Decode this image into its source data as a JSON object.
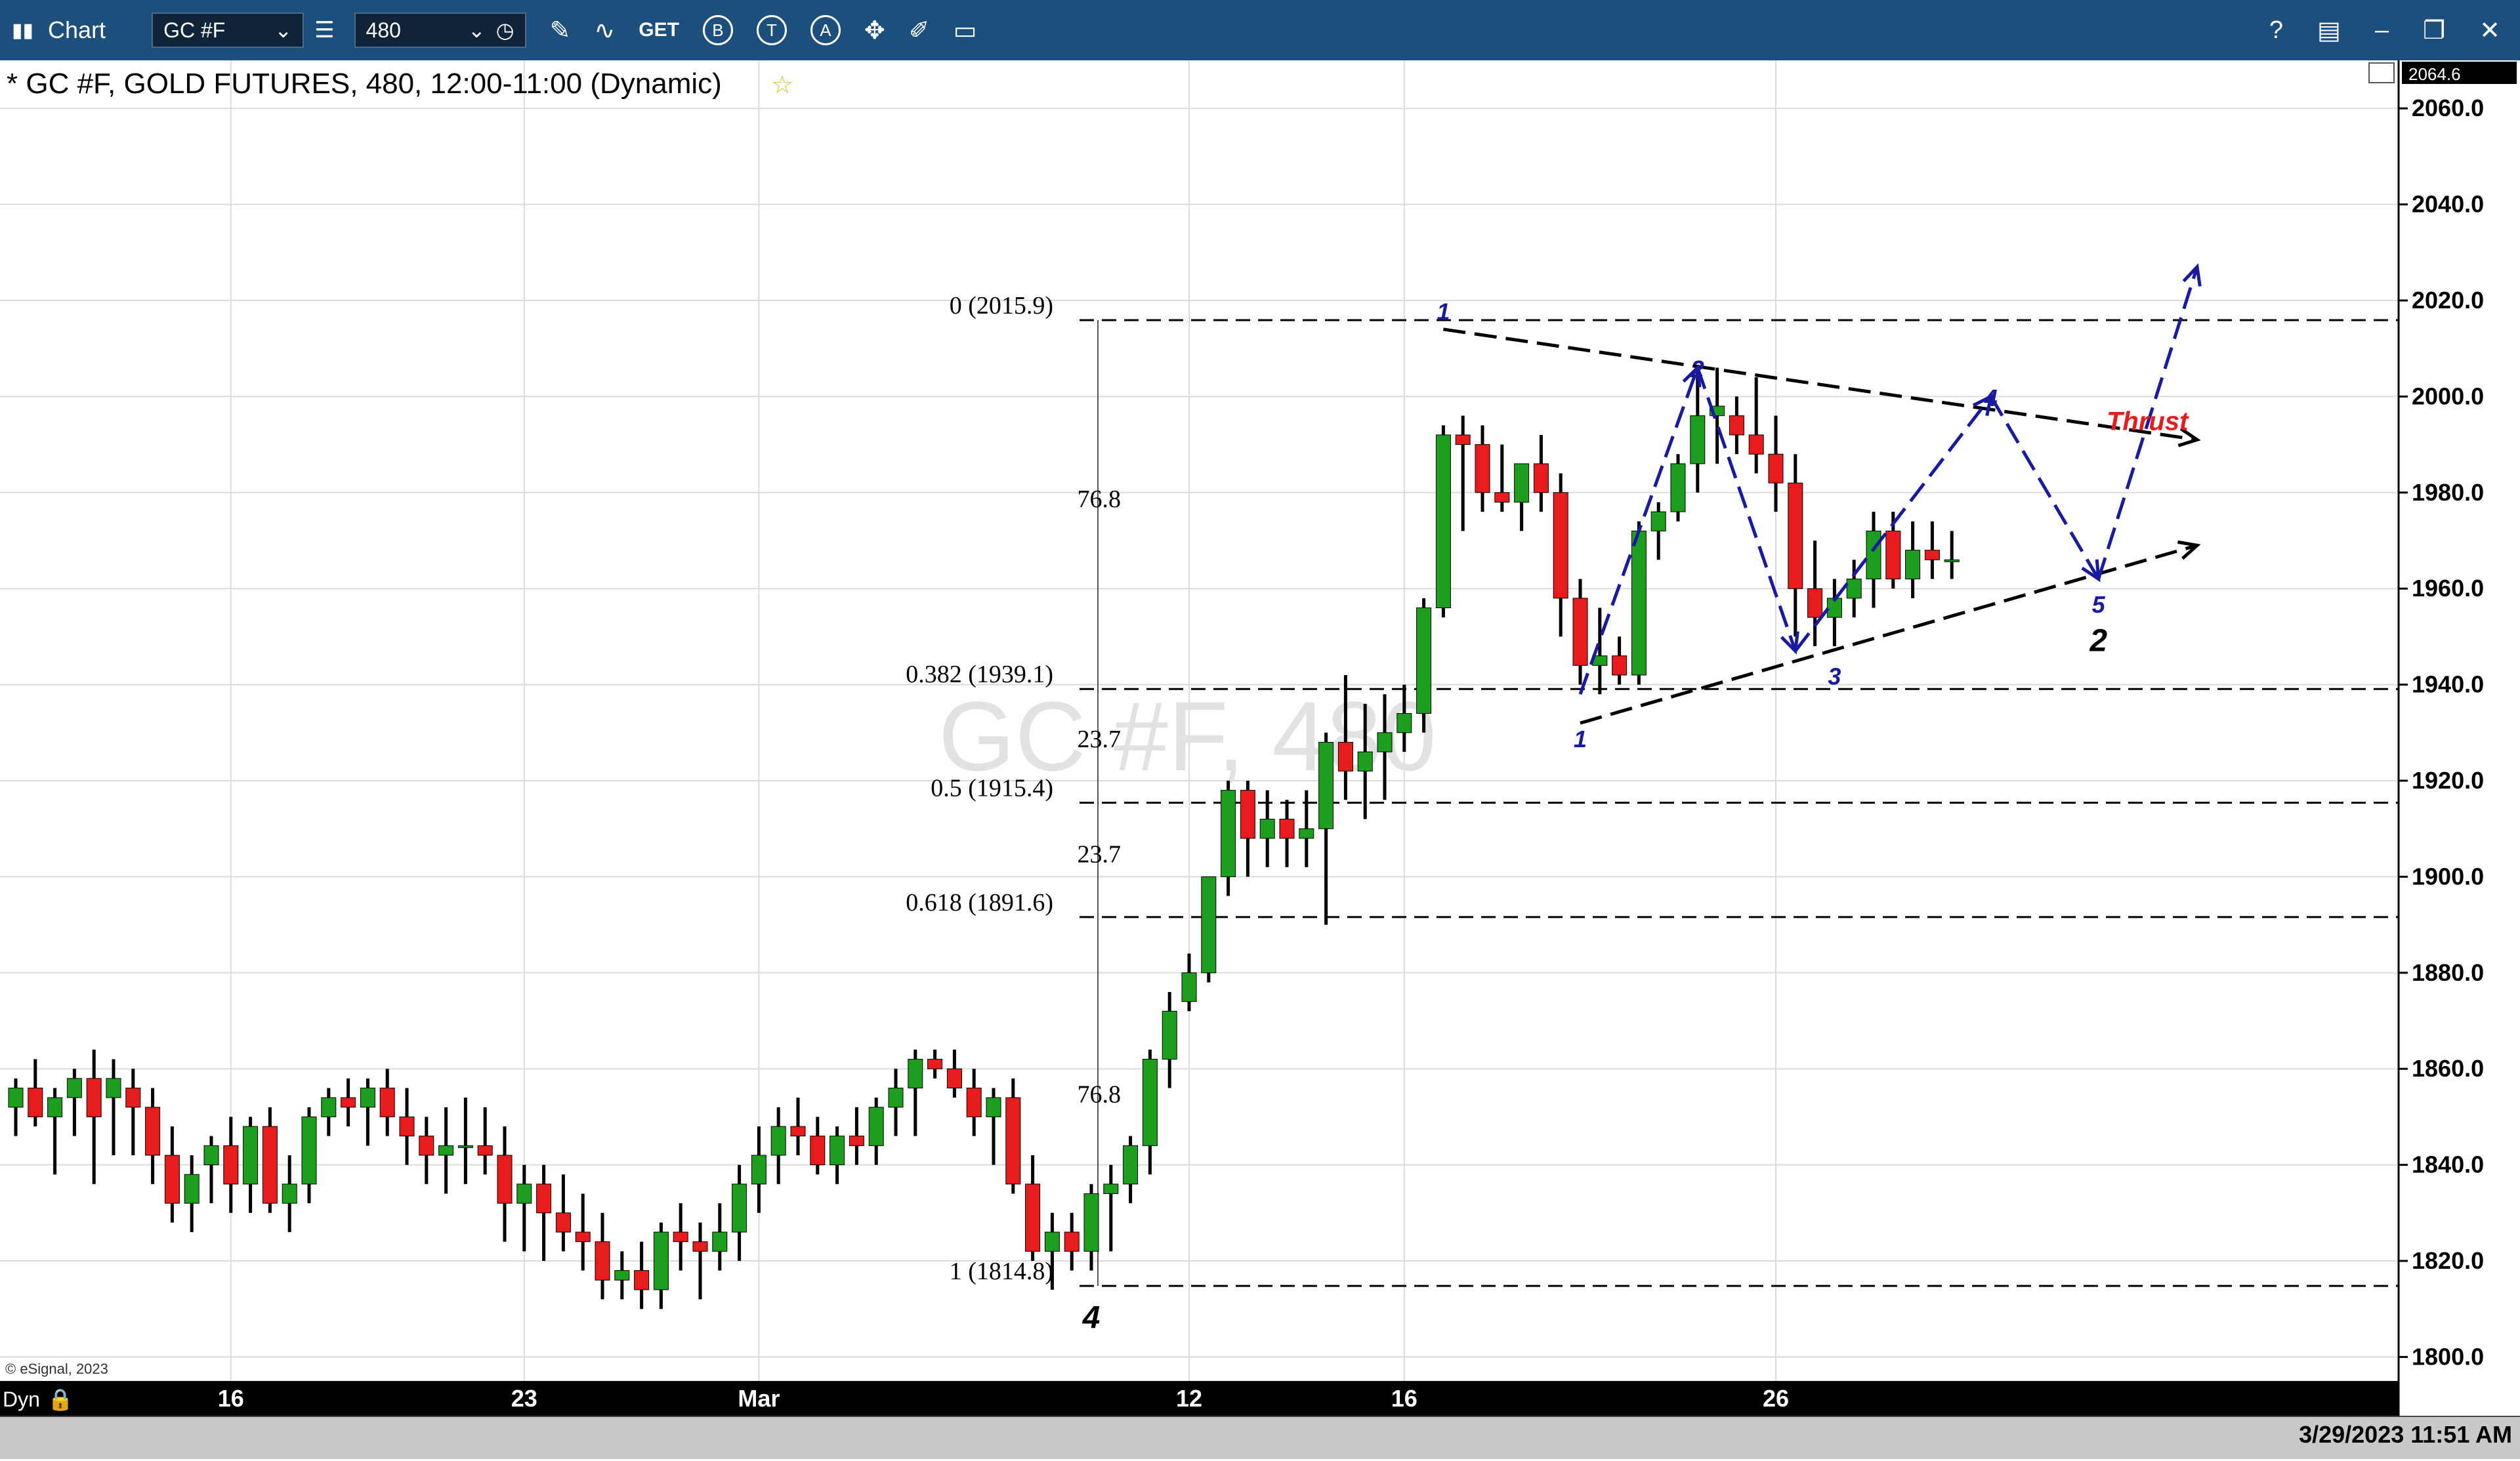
{
  "toolbar": {
    "app_label": "Chart",
    "symbol": "GC #F",
    "interval": "480",
    "get_label": "GET",
    "btn_b": "B",
    "btn_t": "T",
    "btn_a": "A",
    "help": "?"
  },
  "chart_title": "* GC #F, GOLD FUTURES, 480, 12:00-11:00 (Dynamic)",
  "watermark": "GC #F, 480",
  "copyright": "© eSignal, 2023",
  "dyn_label": "Dyn",
  "timestamp": "3/29/2023 11:51 AM",
  "price_top": "2064.6",
  "last_price": "1966.2",
  "colors": {
    "up": "#1e9e1e",
    "down": "#e81c1c",
    "wave": "#1a1a9e",
    "thrust": "#e81c1c",
    "toolbar": "#1d4f7c"
  },
  "chart_data": {
    "type": "candlestick",
    "title": "GC #F, GOLD FUTURES, 480, 12:00-11:00 (Dynamic)",
    "ylim": [
      1795,
      2070
    ],
    "y_ticks": [
      "1800.0",
      "1820.0",
      "1840.0",
      "1860.0",
      "1880.0",
      "1900.0",
      "1920.0",
      "1940.0",
      "1960.0",
      "1980.0",
      "2000.0",
      "2020.0",
      "2040.0",
      "2060.0"
    ],
    "x_ticks": [
      {
        "label": "16",
        "bar": 11
      },
      {
        "label": "23",
        "bar": 26
      },
      {
        "label": "Mar",
        "bar": 38
      },
      {
        "label": "12",
        "bar": 60
      },
      {
        "label": "16",
        "bar": 71
      },
      {
        "label": "26",
        "bar": 90
      }
    ],
    "ohlc": [
      [
        1852,
        1858,
        1846,
        1856
      ],
      [
        1856,
        1862,
        1848,
        1850
      ],
      [
        1850,
        1856,
        1838,
        1854
      ],
      [
        1854,
        1860,
        1846,
        1858
      ],
      [
        1858,
        1864,
        1836,
        1850
      ],
      [
        1854,
        1862,
        1842,
        1858
      ],
      [
        1856,
        1860,
        1842,
        1852
      ],
      [
        1852,
        1856,
        1836,
        1842
      ],
      [
        1842,
        1848,
        1828,
        1832
      ],
      [
        1832,
        1842,
        1826,
        1838
      ],
      [
        1840,
        1846,
        1832,
        1844
      ],
      [
        1844,
        1850,
        1830,
        1836
      ],
      [
        1836,
        1850,
        1830,
        1848
      ],
      [
        1848,
        1852,
        1830,
        1832
      ],
      [
        1832,
        1842,
        1826,
        1836
      ],
      [
        1836,
        1852,
        1832,
        1850
      ],
      [
        1850,
        1856,
        1846,
        1854
      ],
      [
        1854,
        1858,
        1848,
        1852
      ],
      [
        1852,
        1858,
        1844,
        1856
      ],
      [
        1856,
        1860,
        1846,
        1850
      ],
      [
        1850,
        1856,
        1840,
        1846
      ],
      [
        1846,
        1850,
        1836,
        1842
      ],
      [
        1842,
        1852,
        1834,
        1844
      ],
      [
        1844,
        1854,
        1836,
        1844
      ],
      [
        1844,
        1852,
        1838,
        1842
      ],
      [
        1842,
        1848,
        1824,
        1832
      ],
      [
        1832,
        1840,
        1822,
        1836
      ],
      [
        1836,
        1840,
        1820,
        1830
      ],
      [
        1830,
        1838,
        1822,
        1826
      ],
      [
        1826,
        1834,
        1818,
        1824
      ],
      [
        1824,
        1830,
        1812,
        1816
      ],
      [
        1816,
        1822,
        1812,
        1818
      ],
      [
        1818,
        1824,
        1810,
        1814
      ],
      [
        1814,
        1828,
        1810,
        1826
      ],
      [
        1826,
        1832,
        1818,
        1824
      ],
      [
        1824,
        1828,
        1812,
        1822
      ],
      [
        1822,
        1832,
        1818,
        1826
      ],
      [
        1826,
        1840,
        1820,
        1836
      ],
      [
        1836,
        1848,
        1830,
        1842
      ],
      [
        1842,
        1852,
        1836,
        1848
      ],
      [
        1848,
        1854,
        1842,
        1846
      ],
      [
        1846,
        1850,
        1838,
        1840
      ],
      [
        1840,
        1848,
        1836,
        1846
      ],
      [
        1846,
        1852,
        1840,
        1844
      ],
      [
        1844,
        1854,
        1840,
        1852
      ],
      [
        1852,
        1860,
        1846,
        1856
      ],
      [
        1856,
        1864,
        1846,
        1862
      ],
      [
        1862,
        1864,
        1858,
        1860
      ],
      [
        1860,
        1864,
        1854,
        1856
      ],
      [
        1856,
        1860,
        1846,
        1850
      ],
      [
        1850,
        1856,
        1840,
        1854
      ],
      [
        1854,
        1858,
        1834,
        1836
      ],
      [
        1836,
        1842,
        1820,
        1822
      ],
      [
        1822,
        1830,
        1814,
        1826
      ],
      [
        1826,
        1830,
        1818,
        1822
      ],
      [
        1822,
        1836,
        1818,
        1834
      ],
      [
        1834,
        1840,
        1822,
        1836
      ],
      [
        1836,
        1846,
        1832,
        1844
      ],
      [
        1844,
        1864,
        1838,
        1862
      ],
      [
        1862,
        1876,
        1856,
        1872
      ],
      [
        1874,
        1884,
        1872,
        1880
      ],
      [
        1880,
        1896,
        1878,
        1900
      ],
      [
        1900,
        1920,
        1896,
        1918
      ],
      [
        1918,
        1920,
        1900,
        1908
      ],
      [
        1908,
        1918,
        1902,
        1912
      ],
      [
        1912,
        1916,
        1902,
        1908
      ],
      [
        1908,
        1918,
        1902,
        1910
      ],
      [
        1910,
        1930,
        1890,
        1928
      ],
      [
        1928,
        1942,
        1916,
        1922
      ],
      [
        1922,
        1936,
        1912,
        1926
      ],
      [
        1926,
        1938,
        1916,
        1930
      ],
      [
        1930,
        1940,
        1926,
        1934
      ],
      [
        1934,
        1958,
        1930,
        1956
      ],
      [
        1956,
        1994,
        1954,
        1992
      ],
      [
        1992,
        1996,
        1972,
        1990
      ],
      [
        1990,
        1994,
        1976,
        1980
      ],
      [
        1980,
        1990,
        1976,
        1978
      ],
      [
        1978,
        1986,
        1972,
        1986
      ],
      [
        1986,
        1992,
        1976,
        1980
      ],
      [
        1980,
        1984,
        1950,
        1958
      ],
      [
        1958,
        1962,
        1940,
        1944
      ],
      [
        1944,
        1956,
        1938,
        1946
      ],
      [
        1946,
        1950,
        1940,
        1942
      ],
      [
        1942,
        1974,
        1940,
        1972
      ],
      [
        1972,
        1978,
        1966,
        1976
      ],
      [
        1976,
        1988,
        1974,
        1986
      ],
      [
        1986,
        2006,
        1980,
        1996
      ],
      [
        1996,
        2006,
        1986,
        1998
      ],
      [
        1996,
        2000,
        1988,
        1992
      ],
      [
        1992,
        2004,
        1984,
        1988
      ],
      [
        1988,
        1996,
        1976,
        1982
      ],
      [
        1982,
        1988,
        1950,
        1960
      ],
      [
        1960,
        1970,
        1948,
        1954
      ],
      [
        1954,
        1962,
        1948,
        1958
      ],
      [
        1958,
        1966,
        1954,
        1962
      ],
      [
        1962,
        1976,
        1956,
        1972
      ],
      [
        1972,
        1976,
        1960,
        1962
      ],
      [
        1962,
        1974,
        1958,
        1968
      ],
      [
        1968,
        1974,
        1962,
        1966
      ],
      [
        1966,
        1972,
        1962,
        1966
      ]
    ],
    "fib_levels": [
      {
        "label": "0 (2015.9)",
        "value": 2015.9
      },
      {
        "label": "0.382 (1939.1)",
        "value": 1939.1
      },
      {
        "label": "0.5 (1915.4)",
        "value": 1915.4
      },
      {
        "label": "0.618 (1891.6)",
        "value": 1891.6
      },
      {
        "label": "1 (1814.8)",
        "value": 1814.8
      }
    ],
    "side_labels": [
      {
        "text": "76.8",
        "value": 1977
      },
      {
        "text": "23.7",
        "value": 1927
      },
      {
        "text": "23.7",
        "value": 1903
      },
      {
        "text": "76.8",
        "value": 1853
      }
    ],
    "wave_labels": [
      {
        "text": "1",
        "bar": 73,
        "value": 2016,
        "color": "wave"
      },
      {
        "text": "2",
        "bar": 86,
        "value": 2004,
        "color": "wave"
      },
      {
        "text": "3",
        "bar": 93,
        "value": 1940,
        "color": "wave"
      },
      {
        "text": "4",
        "bar": 101,
        "value": 1998,
        "color": "wave"
      },
      {
        "text": "5",
        "bar": 106.5,
        "value": 1955,
        "color": "wave"
      },
      {
        "text": "1",
        "bar": 80,
        "value": 1927,
        "color": "wave"
      },
      {
        "text": "2",
        "bar": 106.5,
        "value": 1947,
        "color": "black"
      },
      {
        "text": "4",
        "bar": 55,
        "value": 1806,
        "color": "black"
      },
      {
        "text": "Thrust",
        "bar": 109,
        "value": 1993,
        "color": "thrust"
      }
    ]
  }
}
